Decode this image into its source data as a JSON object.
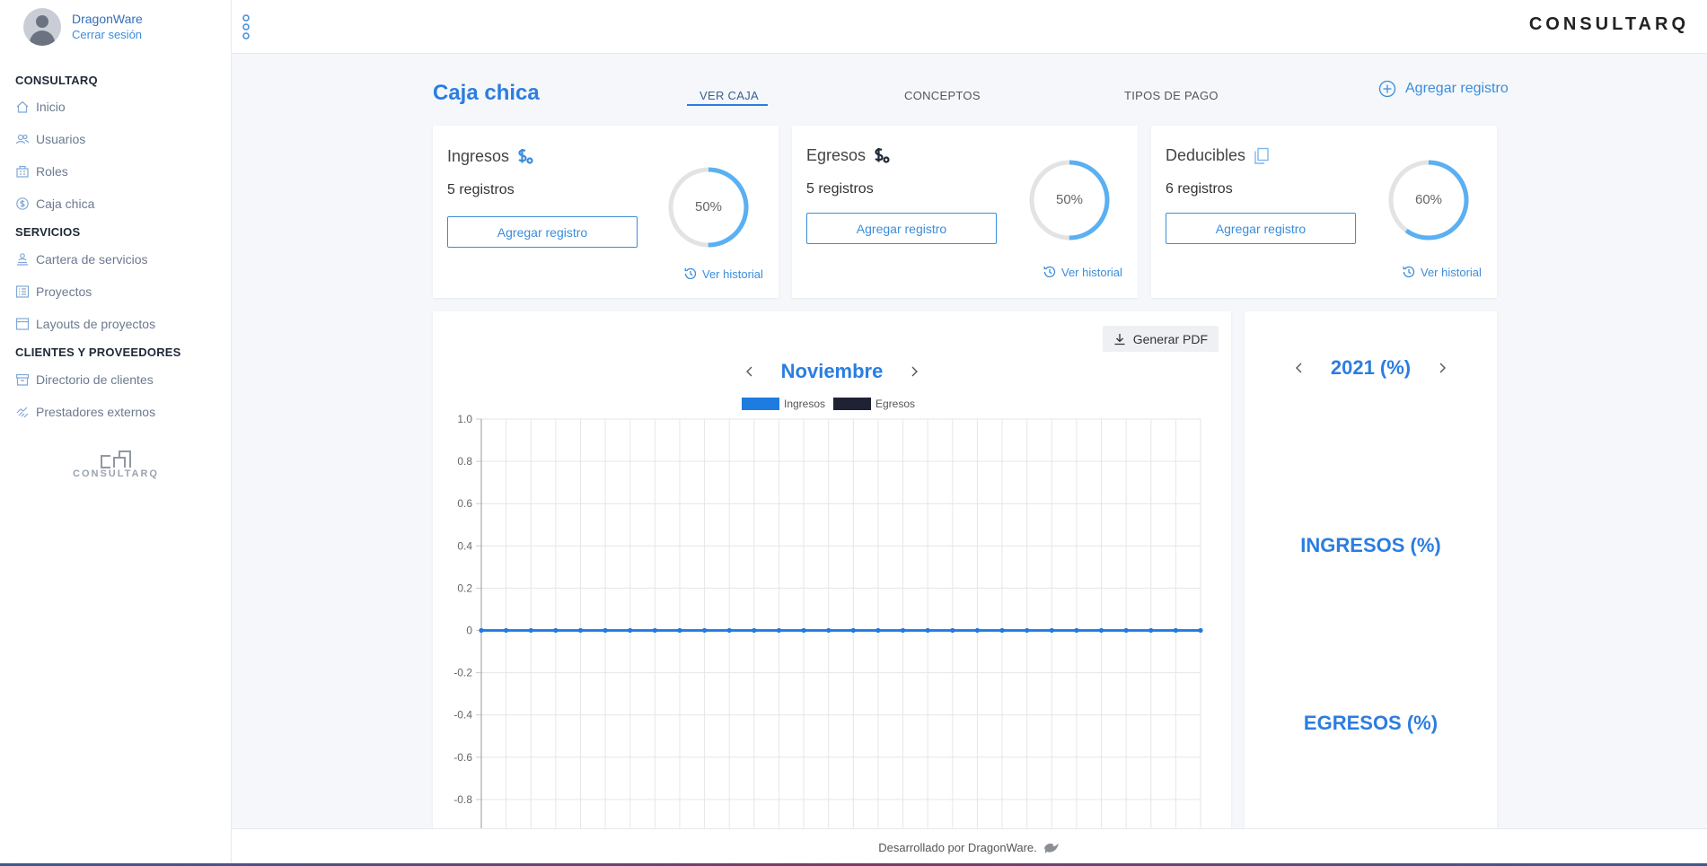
{
  "user": {
    "name": "DragonWare",
    "logout_label": "Cerrar sesión"
  },
  "brand": "CONSULTARQ",
  "sidebar": {
    "sections": [
      {
        "title": "CONSULTARQ",
        "items": [
          {
            "label": "Inicio",
            "icon": "home-icon"
          },
          {
            "label": "Usuarios",
            "icon": "users-icon"
          },
          {
            "label": "Roles",
            "icon": "roles-icon"
          },
          {
            "label": "Caja chica",
            "icon": "dollar-circle-icon"
          }
        ]
      },
      {
        "title": "SERVICIOS",
        "items": [
          {
            "label": "Cartera de servicios",
            "icon": "services-icon"
          },
          {
            "label": "Proyectos",
            "icon": "list-icon"
          },
          {
            "label": "Layouts de proyectos",
            "icon": "layout-icon"
          }
        ]
      },
      {
        "title": "CLIENTES Y PROVEEDORES",
        "items": [
          {
            "label": "Directorio de clientes",
            "icon": "archive-icon"
          },
          {
            "label": "Prestadores externos",
            "icon": "handshake-icon"
          }
        ]
      }
    ],
    "logo_text": "CONSULTARQ"
  },
  "page": {
    "title": "Caja chica",
    "tabs": [
      "VER CAJA",
      "CONCEPTOS",
      "TIPOS DE PAGO"
    ],
    "active_tab": "VER CAJA",
    "add_record_label": "Agregar registro"
  },
  "cards": [
    {
      "label": "Ingresos",
      "count": "5 registros",
      "button": "Agregar registro",
      "percent_text": "50%",
      "percent": 50,
      "history": "Ver historial",
      "icon": "dollar-icon",
      "icon_color": "#3b8ddb"
    },
    {
      "label": "Egresos",
      "count": "5 registros",
      "button": "Agregar registro",
      "percent_text": "50%",
      "percent": 50,
      "history": "Ver historial",
      "icon": "dollar-icon",
      "icon_color": "#1f2937"
    },
    {
      "label": "Deducibles",
      "count": "6 registros",
      "button": "Agregar registro",
      "percent_text": "60%",
      "percent": 60,
      "history": "Ver historial",
      "icon": "documents-icon",
      "icon_color": "#7fb6ea"
    }
  ],
  "chart_panel": {
    "pdf_label": "Generar PDF",
    "month": "Noviembre"
  },
  "year_panel": {
    "year": "2021 (%)",
    "ingresos": "INGRESOS (%)",
    "egresos": "EGRESOS (%)"
  },
  "footer": "Desarrollado por DragonWare.",
  "colors": {
    "accent": "#2b7de1",
    "ingresos": "#1e7be0",
    "egresos": "#1f2233",
    "ring_track": "#e3e3e3",
    "ring_fill": "#5ab0f2"
  },
  "chart_data": {
    "type": "line",
    "legend": [
      "Ingresos",
      "Egresos"
    ],
    "legend_placement": "top",
    "y_ticks": [
      "1.0",
      "0.8",
      "0.6",
      "0.4",
      "0.2",
      "0",
      "-0.2",
      "-0.4",
      "-0.6",
      "-0.8"
    ],
    "ylim": [
      -0.8,
      1.0
    ],
    "x_count": 30,
    "grid": true,
    "series": [
      {
        "name": "Ingresos",
        "values": [
          0,
          0,
          0,
          0,
          0,
          0,
          0,
          0,
          0,
          0,
          0,
          0,
          0,
          0,
          0,
          0,
          0,
          0,
          0,
          0,
          0,
          0,
          0,
          0,
          0,
          0,
          0,
          0,
          0,
          0
        ]
      },
      {
        "name": "Egresos",
        "values": [
          0,
          0,
          0,
          0,
          0,
          0,
          0,
          0,
          0,
          0,
          0,
          0,
          0,
          0,
          0,
          0,
          0,
          0,
          0,
          0,
          0,
          0,
          0,
          0,
          0,
          0,
          0,
          0,
          0,
          0
        ]
      }
    ]
  }
}
